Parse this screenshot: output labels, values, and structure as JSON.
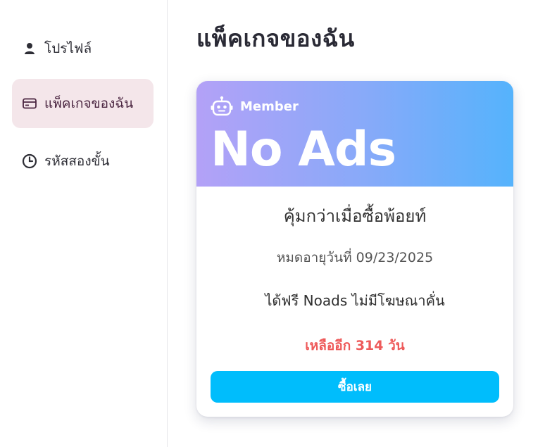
{
  "sidebar": {
    "items": [
      {
        "label": "โปรไฟล์",
        "icon": "user-icon",
        "active": false
      },
      {
        "label": "แพ็คเกจของฉัน",
        "icon": "credit-card-icon",
        "active": true
      },
      {
        "label": "รหัสสองขั้น",
        "icon": "clock-icon",
        "active": false
      }
    ]
  },
  "main": {
    "title": "แพ็คเกจของฉัน",
    "card": {
      "badge_icon": "robot-icon",
      "badge": "Member",
      "plan_name": "No Ads",
      "tagline": "คุ้มกว่าเมื่อซื้อพ้อยท์",
      "expiry": "หมดอายุวันที่ 09/23/2025",
      "benefit": "ได้ฟรี Noads ไม่มีโฆษณาคั่น",
      "remaining": "เหลืออีก 314 วัน",
      "buy_button": "ซื้อเลย"
    }
  },
  "colors": {
    "accent_button": "#00bdfc",
    "remaining_text": "#ee5a5a",
    "header_gradient_start": "#b3a1f7",
    "header_gradient_end": "#55b3fc",
    "active_nav_bg": "#f4e6ea"
  }
}
